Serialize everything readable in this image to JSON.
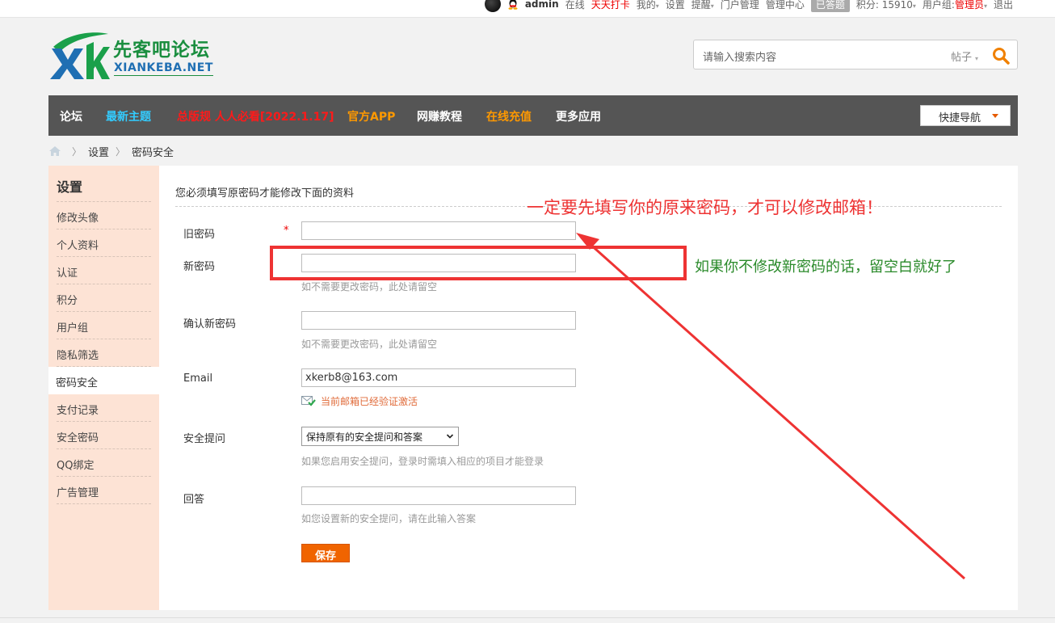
{
  "topbar": {
    "username": "admin",
    "online": "在线",
    "checkin": "天天打卡",
    "mine": "我的",
    "settings": "设置",
    "remind": "提醒",
    "portal": "门户管理",
    "admin_center": "管理中心",
    "answered": "已答题",
    "points": "积分: 15910",
    "usergroup_label": "用户组:",
    "usergroup": "管理员",
    "logout": "退出"
  },
  "logo": {
    "cn": "先客吧论坛",
    "en": "XIANKEBA.NET"
  },
  "search": {
    "placeholder": "请输入搜索内容",
    "type": "帖子"
  },
  "nav": {
    "items": [
      {
        "label": "论坛",
        "color": "#ffffff"
      },
      {
        "label": "最新主题",
        "color": "#33ccff"
      },
      {
        "label": "总版规 人人必看[2022.1.17]",
        "color": "#ff1a1a"
      },
      {
        "label": "官方APP",
        "color": "#ff9900"
      },
      {
        "label": "网赚教程",
        "color": "#ffffff"
      },
      {
        "label": "在线充值",
        "color": "#ff9900"
      },
      {
        "label": "更多应用",
        "color": "#ffffff"
      }
    ],
    "quick": "快捷导航"
  },
  "breadcrumb": {
    "items": [
      "设置",
      "密码安全"
    ]
  },
  "sidebar": {
    "title": "设置",
    "items": [
      "修改头像",
      "个人资料",
      "认证",
      "积分",
      "用户组",
      "隐私筛选",
      "密码安全",
      "支付记录",
      "安全密码",
      "QQ绑定",
      "广告管理"
    ],
    "active": "密码安全"
  },
  "form": {
    "notice": "您必须填写原密码才能修改下面的资料",
    "old_password": {
      "label": "旧密码",
      "required": "*",
      "value": ""
    },
    "new_password": {
      "label": "新密码",
      "value": "",
      "hint": "如不需要更改密码，此处请留空"
    },
    "confirm_password": {
      "label": "确认新密码",
      "value": "",
      "hint": "如不需要更改密码，此处请留空"
    },
    "email": {
      "label": "Email",
      "value": "xkerb8@163.com",
      "status": "当前邮箱已经验证激活"
    },
    "question": {
      "label": "安全提问",
      "selected": "保持原有的安全提问和答案",
      "hint": "如果您启用安全提问，登录时需填入相应的项目才能登录"
    },
    "answer": {
      "label": "回答",
      "value": "",
      "hint": "如您设置新的安全提问，请在此输入答案"
    },
    "save": "保存"
  },
  "annotations": {
    "top": "一定要先填写你的原来密码，才可以修改邮箱！",
    "side": "如果你不修改新密码的话，留空白就好了"
  }
}
